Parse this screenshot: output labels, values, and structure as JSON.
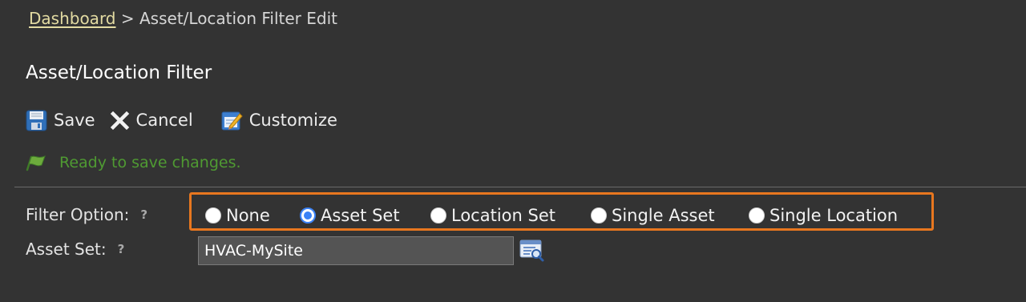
{
  "breadcrumb": {
    "link": "Dashboard",
    "separator": " > ",
    "current": "Asset/Location Filter Edit"
  },
  "page": {
    "title": "Asset/Location Filter"
  },
  "toolbar": {
    "save_label": "Save",
    "cancel_label": "Cancel",
    "customize_label": "Customize"
  },
  "status": {
    "message": "Ready to save changes.",
    "color": "#4f9a32"
  },
  "form": {
    "filter_option": {
      "label": "Filter Option:",
      "help": "?",
      "options": [
        {
          "label": "None",
          "selected": false
        },
        {
          "label": "Asset Set",
          "selected": true
        },
        {
          "label": "Location Set",
          "selected": false
        },
        {
          "label": "Single Asset",
          "selected": false
        },
        {
          "label": "Single Location",
          "selected": false
        }
      ],
      "highlight_color": "#e8771f"
    },
    "asset_set": {
      "label": "Asset Set:",
      "help": "?",
      "value": "HVAC-MySite"
    }
  },
  "colors": {
    "background": "#333333",
    "link": "#e3dba2",
    "radio_selected": "#3b82f6"
  }
}
